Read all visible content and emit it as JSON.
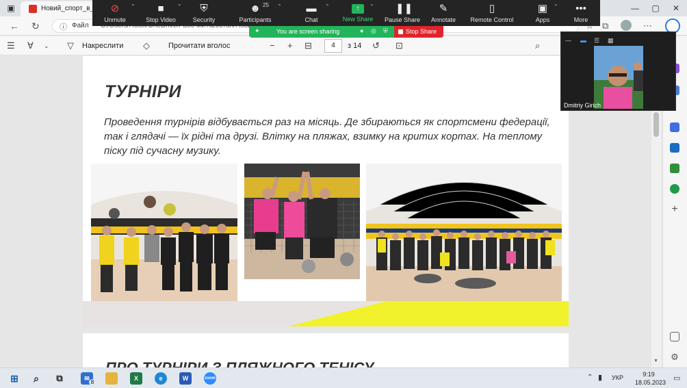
{
  "browser": {
    "tab_title": "Новий_спорт_в_Ук",
    "address_label": "Файл",
    "address_path": "C:/Users/Псюх/OneDrive/Рабочий%20стол/Новий...",
    "nav_back": "←",
    "nav_refresh": "↻"
  },
  "pdf_toolbar": {
    "draw_label": "Накреслити",
    "read_aloud_label": "Прочитати вголос",
    "current_page": "4",
    "total_pages": "з 14",
    "zoom_out": "−",
    "zoom_in": "+"
  },
  "zoom_toolbar": {
    "items": [
      {
        "label": "Unmute",
        "icon": "mic-off-icon"
      },
      {
        "label": "Stop Video",
        "icon": "video-icon"
      },
      {
        "label": "Security",
        "icon": "shield-icon"
      },
      {
        "label": "Participants",
        "icon": "participants-icon",
        "badge": "25"
      },
      {
        "label": "Chat",
        "icon": "chat-icon"
      },
      {
        "label": "New Share",
        "icon": "share-icon"
      },
      {
        "label": "Pause Share",
        "icon": "pause-icon"
      },
      {
        "label": "Annotate",
        "icon": "pen-icon"
      },
      {
        "label": "Remote Control",
        "icon": "mouse-icon"
      },
      {
        "label": "Apps",
        "icon": "apps-icon"
      },
      {
        "label": "More",
        "icon": "more-icon"
      }
    ]
  },
  "share_banner": {
    "text": "You are screen sharing",
    "stop_label": "Stop Share"
  },
  "document": {
    "section_title": "ТУРНІРИ",
    "section_text": "Проведення турнірів відбувається раз на місяць. Де збираються як спортсмени федерації, так і глядачі — їх рідні та друзі. Влітку на пляжах, взимку на критих кортах. На теплому піску під сучасну музику.",
    "next_section_title": "ПРО ТУРНІРИ З ПЛЯЖНОГО ТЕНІСУ"
  },
  "video": {
    "participant_name": "Dmitriy Girich"
  },
  "taskbar": {
    "mail_badge": "8",
    "language": "УКР",
    "time": "9:19",
    "date": "18.05.2023"
  }
}
